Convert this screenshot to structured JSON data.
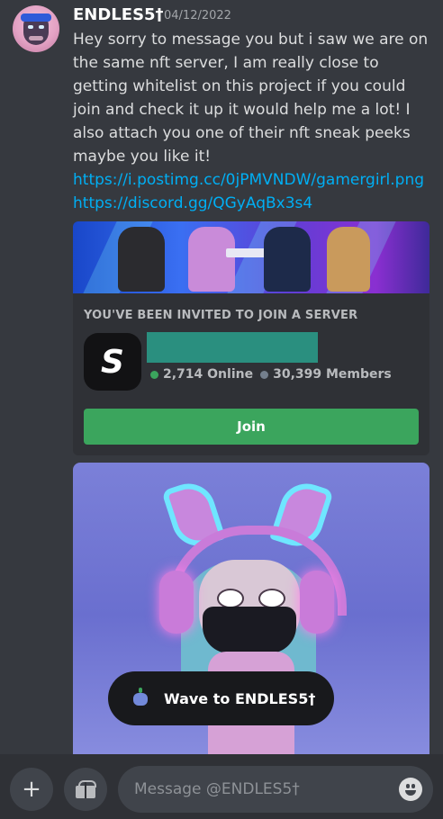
{
  "message": {
    "username": "ENDLES5†",
    "timestamp": "04/12/2022",
    "text_parts": [
      "Hey sorry to message you but i saw we are on the same nft server, I am really close to getting whitelist on this project if you could join and check it up it would help me a lot! I also attach you one of their nft sneak peeks maybe you like it! ",
      "https://i.postimg.cc/0jPMVNDW/gamergirl.png",
      " ",
      "https://discord.gg/QGyAqBx3s4"
    ]
  },
  "invite": {
    "title": "YOU'VE BEEN INVITED TO JOIN A SERVER",
    "server_icon_letter": "S",
    "online": "2,714 Online",
    "members": "30,399 Members",
    "join_label": "Join"
  },
  "wave": {
    "label": "Wave to ENDLES5†"
  },
  "composer": {
    "placeholder": "Message @ENDLES5†",
    "plus_icon": "+"
  },
  "colors": {
    "background": "#36393f",
    "link": "#00aff4",
    "join": "#3ba55d",
    "server_name_redaction": "#2a8f7f"
  }
}
